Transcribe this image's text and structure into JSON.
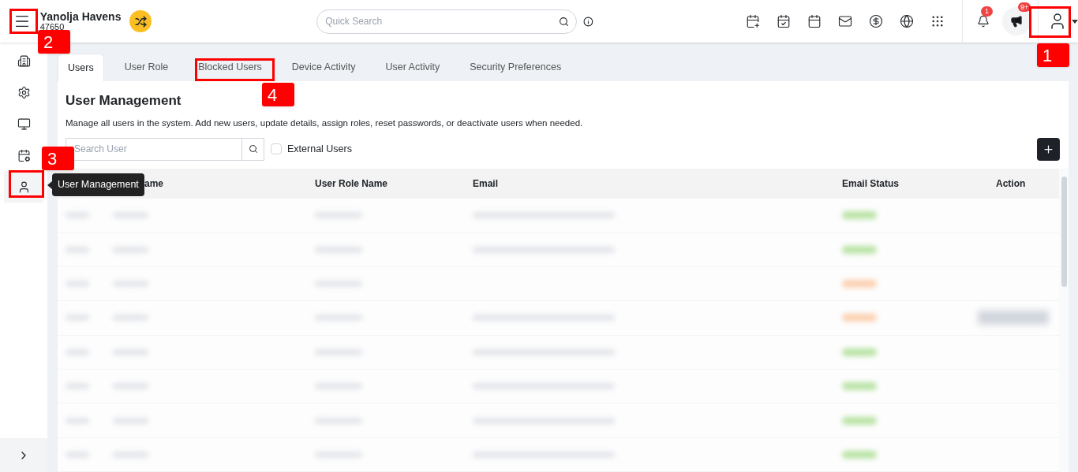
{
  "header": {
    "property_name": "Yanolja Havens",
    "property_id": "47650",
    "search": {
      "placeholder": "Quick Search"
    },
    "notifications_count": "1",
    "announcements_count": "9+"
  },
  "sidebar": {
    "items": [
      {
        "kind": "building",
        "selected": false
      },
      {
        "kind": "settings",
        "selected": false
      },
      {
        "kind": "monitor",
        "selected": false
      },
      {
        "kind": "calendar",
        "selected": false
      },
      {
        "kind": "user",
        "selected": true
      }
    ]
  },
  "tooltip": "User Management",
  "tabs": [
    {
      "label": "Users",
      "selected": true
    },
    {
      "label": "User Role",
      "selected": false
    },
    {
      "label": "Blocked Users",
      "selected": false
    },
    {
      "label": "Device Activity",
      "selected": false
    },
    {
      "label": "User Activity",
      "selected": false
    },
    {
      "label": "Security Preferences",
      "selected": false
    }
  ],
  "page": {
    "title": "User Management",
    "description": "Manage all users in the system. Add new users, update details, assign roles, reset passwords, or deactivate users when needed.",
    "search": {
      "placeholder": "Search User"
    },
    "external_users": {
      "label": "External Users",
      "checked": false
    }
  },
  "table": {
    "columns": [
      {
        "label": "ame"
      },
      {
        "label": "User Role Name"
      },
      {
        "label": "Email"
      },
      {
        "label": "Email Status"
      },
      {
        "label": "Action"
      }
    ],
    "rows": [
      {
        "email_shown": true,
        "action_shown": false,
        "color": "#b9e3a6"
      },
      {
        "email_shown": true,
        "action_shown": false,
        "color": "#b9e3a6"
      },
      {
        "email_shown": false,
        "action_shown": false,
        "color": "#fbd0b0"
      },
      {
        "email_shown": true,
        "action_shown": true,
        "color": "#fbd0b0"
      },
      {
        "email_shown": true,
        "action_shown": false,
        "color": "#b9e3a6"
      },
      {
        "email_shown": true,
        "action_shown": false,
        "color": "#b9e3a6"
      },
      {
        "email_shown": true,
        "action_shown": false,
        "color": "#b9e3a6"
      },
      {
        "email_shown": true,
        "action_shown": false,
        "color": "#b9e3a6"
      }
    ]
  },
  "annotations": [
    {
      "number": "1"
    },
    {
      "number": "2"
    },
    {
      "number": "3"
    },
    {
      "number": "4"
    }
  ]
}
